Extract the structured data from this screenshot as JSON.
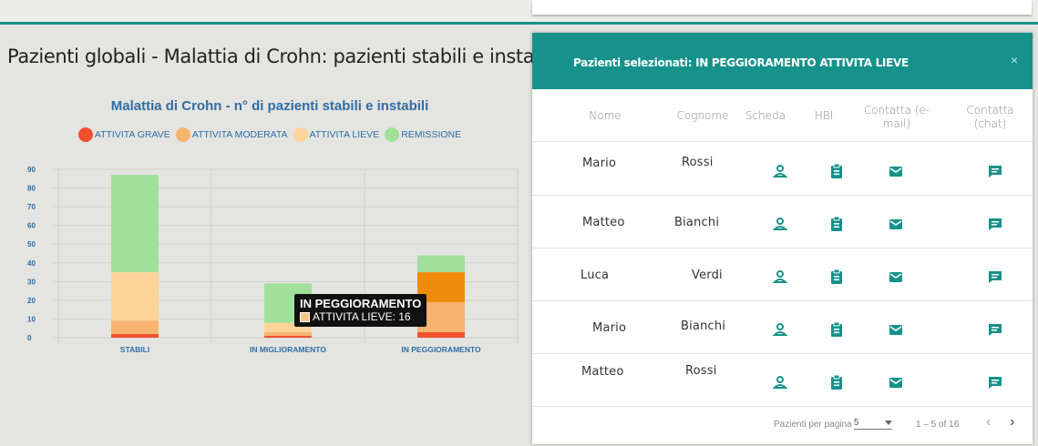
{
  "page": {
    "title": "Pazienti globali - Malattia di Crohn: pazienti stabili e instabili"
  },
  "chart_data": {
    "type": "bar",
    "stacked": true,
    "title": "Malattia di Crohn - n° di pazienti stabili e instabili",
    "categories": [
      "STABILI",
      "IN MIGLIORAMENTO",
      "IN PEGGIORAMENTO"
    ],
    "series": [
      {
        "name": "ATTIVITA GRAVE",
        "color": "#f0502e",
        "values": [
          2,
          1,
          3
        ]
      },
      {
        "name": "ATTIVITA MODERATA",
        "color": "#f7b370",
        "values": [
          7,
          2,
          16
        ]
      },
      {
        "name": "ATTIVITA LIEVE",
        "color": "#fdd49a",
        "values": [
          26,
          5,
          16
        ]
      },
      {
        "name": "REMISSIONE",
        "color": "#a0e09a",
        "values": [
          52,
          21,
          9
        ]
      }
    ],
    "ylim": [
      0,
      90
    ],
    "yticks": [
      0,
      10,
      20,
      30,
      40,
      50,
      60,
      70,
      80,
      90
    ],
    "legend_position": "top",
    "grid": true,
    "highlighted": {
      "category": 2,
      "series": 2,
      "color": "#f08a0a"
    },
    "tooltip": {
      "title": "IN PEGGIORAMENTO",
      "text": "ATTIVITA LIEVE: 16"
    }
  },
  "dialog": {
    "title": "Pazienti selezionati: IN PEGGIORAMENTO ATTIVITA LIEVE",
    "close": "×",
    "columns": [
      "Nome",
      "Cognome",
      "Scheda",
      "HBI",
      "Contatta (e-mail)",
      "Contatta (chat)"
    ],
    "rows": [
      {
        "nome": "Mario",
        "cognome": "Rossi"
      },
      {
        "nome": "Matteo",
        "cognome": "Bianchi"
      },
      {
        "nome": "Luca",
        "cognome": "Verdi"
      },
      {
        "nome": "Mario",
        "cognome": "Bianchi"
      },
      {
        "nome": "Matteo",
        "cognome": "Rossi"
      }
    ],
    "icons": [
      "person-icon",
      "clipboard-icon",
      "mail-icon",
      "chat-icon"
    ],
    "footer": {
      "per_page_label": "Pazienti per pagina",
      "per_page_value": "5",
      "range": "1 – 5 of 16",
      "prev": "‹",
      "next": "›"
    }
  },
  "colors": {
    "accent": "#17918b",
    "teal_icon": "#17918b"
  }
}
